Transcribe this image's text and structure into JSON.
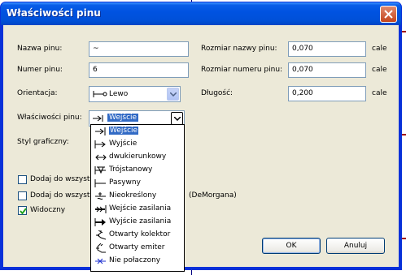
{
  "dialog": {
    "title": "Właściwości pinu",
    "fields": {
      "pin_name_label": "Nazwa pinu:",
      "pin_name_value": "~",
      "pin_number_label": "Numer pinu:",
      "pin_number_value": "6",
      "orientation_label": "Orientacja:",
      "orientation_value": "Lewo",
      "pin_props_label": "Właściwości pinu:",
      "pin_props_value": "Wejście",
      "graphic_style_label": "Styl graficzny:",
      "name_size_label": "Rozmiar nazwy pinu:",
      "name_size_value": "0,070",
      "number_size_label": "Rozmiar numeru pinu:",
      "number_size_value": "0,070",
      "length_label": "Długość:",
      "length_value": "0,200",
      "unit": "cale"
    },
    "checkboxes": [
      {
        "label": "Dodaj do wszyst",
        "checked": false
      },
      {
        "label": "Dodaj do wszyst",
        "checked": false,
        "suffix": "(DeMorgana)"
      },
      {
        "label": "Widoczny",
        "checked": true
      }
    ],
    "buttons": {
      "ok": "OK",
      "cancel": "Anuluj"
    },
    "dropdown_options": [
      {
        "label": "Wejście",
        "icon": "input-arrow-icon",
        "selected": true
      },
      {
        "label": "Wyjście",
        "icon": "output-arrow-icon",
        "selected": false
      },
      {
        "label": "dwukierunkowy",
        "icon": "bidirectional-icon",
        "selected": false
      },
      {
        "label": "Trójstanowy",
        "icon": "tristate-icon",
        "selected": false
      },
      {
        "label": "Pasywny",
        "icon": "passive-icon",
        "selected": false
      },
      {
        "label": "Nieokreślony",
        "icon": "unspecified-icon",
        "selected": false
      },
      {
        "label": "Wejście zasilania",
        "icon": "power-input-icon",
        "selected": false
      },
      {
        "label": "Wyjście zasilania",
        "icon": "power-output-icon",
        "selected": false
      },
      {
        "label": "Otwarty kolektor",
        "icon": "open-collector-icon",
        "selected": false
      },
      {
        "label": "Otwarty emiter",
        "icon": "open-emitter-icon",
        "selected": false
      },
      {
        "label": "Nie połaczony",
        "icon": "not-connected-icon",
        "selected": false
      }
    ]
  },
  "colors": {
    "titlebar": "#0053e1",
    "client": "#ece9d8",
    "selection": "#316ac5",
    "close": "#c4441b"
  }
}
